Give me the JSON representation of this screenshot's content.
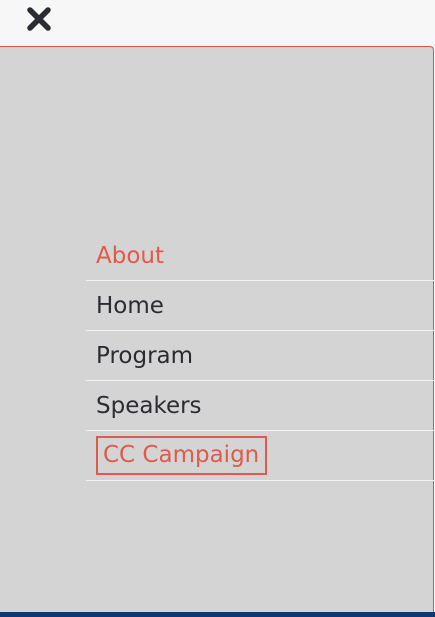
{
  "header": {
    "close_icon": "close-icon"
  },
  "colors": {
    "accent": "#e05a4a",
    "text": "#2b2b33",
    "panel_bg": "#d4d4d4",
    "bottom_bar": "#0d3a6b"
  },
  "menu": {
    "items": [
      {
        "label": "About",
        "state": "active"
      },
      {
        "label": "Home",
        "state": "default"
      },
      {
        "label": "Program",
        "state": "default"
      },
      {
        "label": "Speakers",
        "state": "default"
      },
      {
        "label": "CC Campaign",
        "state": "highlighted-button"
      }
    ]
  }
}
